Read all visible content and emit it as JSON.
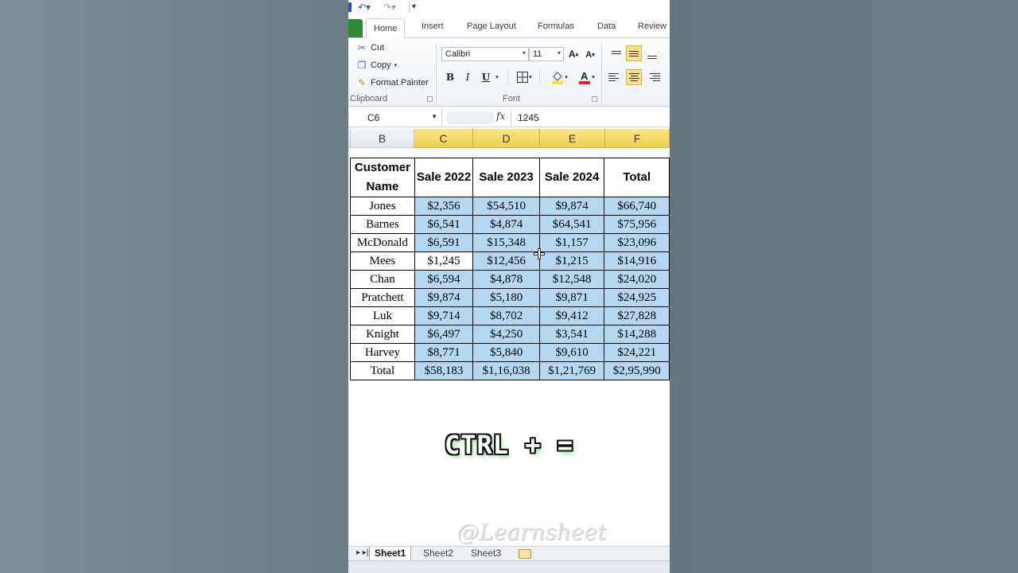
{
  "quick_access": {
    "undo_icon": "undo-icon",
    "redo_icon": "redo-icon",
    "customize_icon": "customize-icon"
  },
  "tabs": [
    "Home",
    "Insert",
    "Page Layout",
    "Formulas",
    "Data",
    "Review"
  ],
  "active_tab": "Home",
  "clipboard": {
    "cut": "Cut",
    "copy": "Copy",
    "format_painter": "Format Painter",
    "group_label": "Clipboard"
  },
  "font": {
    "family": "Calibri",
    "size": "11",
    "bold": "B",
    "italic": "I",
    "underline": "U",
    "grow": "A",
    "shrink": "A",
    "group_label": "Font"
  },
  "formula_bar": {
    "name_box": "C6",
    "fx": "fx",
    "value": "1245"
  },
  "columns": [
    "B",
    "C",
    "D",
    "E",
    "F"
  ],
  "selected_columns": [
    "C",
    "D",
    "E",
    "F"
  ],
  "table": {
    "headers": [
      "Customer Name",
      "Sale 2022",
      "Sale 2023",
      "Sale 2024",
      "Total"
    ],
    "rows": [
      [
        "Jones",
        "$2,356",
        "$54,510",
        "$9,874",
        "$66,740"
      ],
      [
        "Barnes",
        "$6,541",
        "$4,874",
        "$64,541",
        "$75,956"
      ],
      [
        "McDonald",
        "$6,591",
        "$15,348",
        "$1,157",
        "$23,096"
      ],
      [
        "Mees",
        "$1,245",
        "$12,456",
        "$1,215",
        "$14,916"
      ],
      [
        "Chan",
        "$6,594",
        "$4,878",
        "$12,548",
        "$24,020"
      ],
      [
        "Pratchett",
        "$9,874",
        "$5,180",
        "$9,871",
        "$24,925"
      ],
      [
        "Luk",
        "$9,714",
        "$8,702",
        "$9,412",
        "$27,828"
      ],
      [
        "Knight",
        "$6,497",
        "$4,250",
        "$3,541",
        "$14,288"
      ],
      [
        "Harvey",
        "$8,771",
        "$5,840",
        "$9,610",
        "$24,221"
      ],
      [
        "Total",
        "$58,183",
        "$1,16,038",
        "$1,21,769",
        "$2,95,990"
      ]
    ]
  },
  "overlay": {
    "shortcut": "CTRL + =",
    "watermark": "@Learnsheet"
  },
  "sheets": [
    "Sheet1",
    "Sheet2",
    "Sheet3"
  ],
  "active_sheet": "Sheet1",
  "colors": {
    "selection": "#b4d7f2",
    "column_header_selected": "#f2d04c",
    "file_tab": "#2e8b35"
  }
}
